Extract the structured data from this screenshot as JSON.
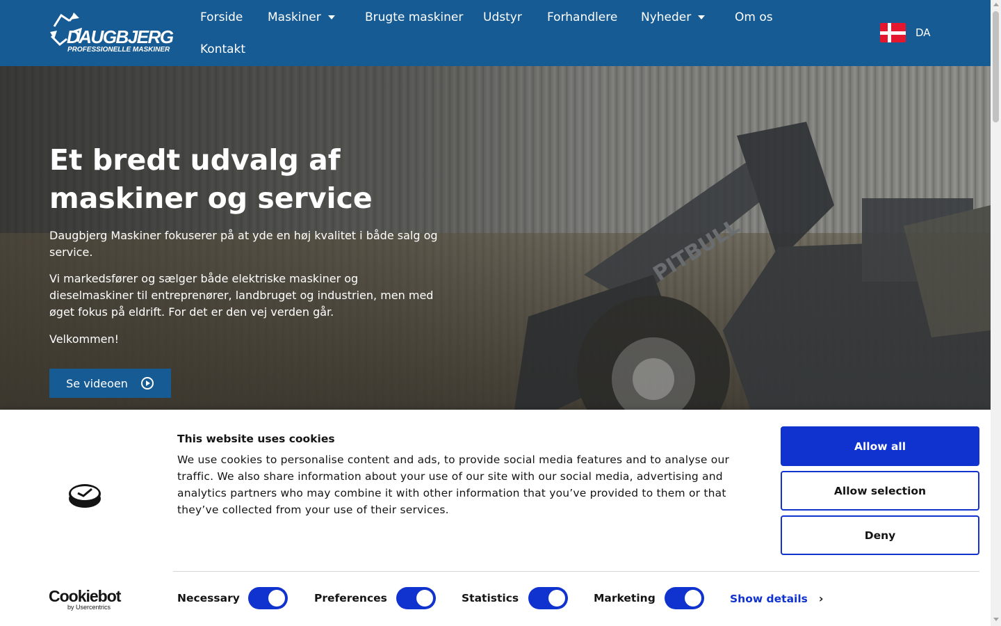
{
  "brand": {
    "name": "DAUGBJERG",
    "tagline": "PROFESSIONELLE MASKINER"
  },
  "nav": {
    "items": [
      {
        "label": "Forside"
      },
      {
        "label": "Maskiner"
      },
      {
        "label": "Brugte maskiner"
      },
      {
        "label": "Udstyr"
      },
      {
        "label": "Forhandlere"
      },
      {
        "label": "Nyheder"
      },
      {
        "label": "Om os"
      },
      {
        "label": "Kontakt"
      }
    ],
    "dropdown_icon": "caret-down-icon"
  },
  "language": {
    "label": "DA",
    "flag": "danish-flag-icon"
  },
  "hero": {
    "title": "Et bredt udvalg af maskiner og service",
    "paragraphs": [
      "Daugbjerg Maskiner fokuserer på at yde en høj kvalitet i både salg og service.",
      "Vi markedsfører og sælger både elektriske maskiner og dieselmaskiner til entreprenører, landbruget og industrien, men med øget fokus på eldrift. For det er den vej verden går.",
      "Velkommen!"
    ],
    "button_label": "Se videoen",
    "button_icon": "play-circle-icon",
    "machine_label": "PITBULL"
  },
  "cookie": {
    "title": "This website uses cookies",
    "text": "We use cookies to personalise content and ads, to provide social media features and to analyse our traffic. We also share information about your use of our site with our social media, advertising and analytics partners who may combine it with other information that you’ve provided to them or that they’ve collected from your use of their services.",
    "buttons": {
      "allow_all": "Allow all",
      "allow_selection": "Allow selection",
      "deny": "Deny"
    },
    "toggles": [
      {
        "label": "Necessary",
        "checked": true
      },
      {
        "label": "Preferences",
        "checked": true
      },
      {
        "label": "Statistics",
        "checked": true
      },
      {
        "label": "Marketing",
        "checked": true
      }
    ],
    "show_details": "Show details",
    "logo_main": "Cookiebot",
    "logo_sub": "by Usercentrics"
  },
  "colors": {
    "header": "#175b94",
    "cookie_accent": "#1032cf",
    "flag_red": "#e4172e"
  }
}
